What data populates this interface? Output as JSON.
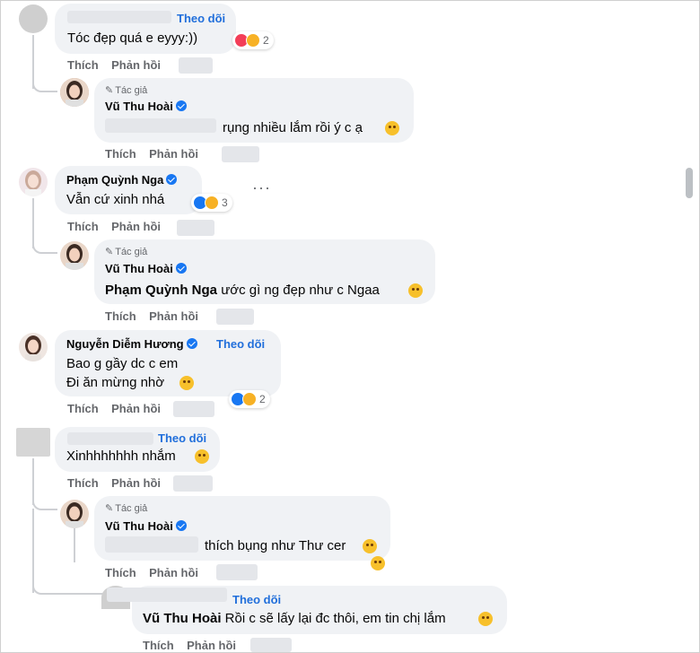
{
  "comments": {
    "c1": {
      "text": "Tóc đẹp quá e eyyy:))",
      "follow": "Theo dõi",
      "react_count": "2"
    },
    "c1_reply": {
      "author_tag": "Tác giả",
      "name": "Vũ Thu Hoài",
      "text": "rụng nhiều lắm rồi ý c ạ"
    },
    "c2": {
      "name": "Phạm Quỳnh Nga",
      "text": "Vẫn cứ xinh nhá",
      "react_count": "3",
      "more": "···"
    },
    "c2_reply": {
      "author_tag": "Tác giả",
      "name": "Vũ Thu Hoài",
      "mention": "Phạm Quỳnh Nga",
      "text": " ước gì ng đẹp như c Ngaa"
    },
    "c3": {
      "name": "Nguyễn Diễm Hương",
      "follow": "Theo dõi",
      "line1": "Bao g gầy dc c em",
      "line2": "Đi ăn mừng nhờ",
      "react_count": "2"
    },
    "c4": {
      "follow": "Theo dõi",
      "text": "Xinhhhhhhh nhắm"
    },
    "c4_reply": {
      "author_tag": "Tác giả",
      "name": "Vũ Thu Hoài",
      "text": "thích bụng như Thư cer"
    },
    "c4_reply2": {
      "follow": "Theo dõi",
      "mention": "Vũ Thu Hoài",
      "text": " Rồi c sẽ lấy lại đc thôi, em tin chị lắm"
    }
  },
  "actions": {
    "like": "Thích",
    "reply": "Phản hồi"
  },
  "colors": {
    "accent": "#216fdb",
    "bubble": "#f0f2f5",
    "muted": "#65676b"
  },
  "icons": [
    "pencil-icon",
    "verified-badge-icon",
    "heart-reaction-icon",
    "like-reaction-icon",
    "haha-reaction-icon",
    "care-reaction-icon",
    "more-options-icon"
  ]
}
